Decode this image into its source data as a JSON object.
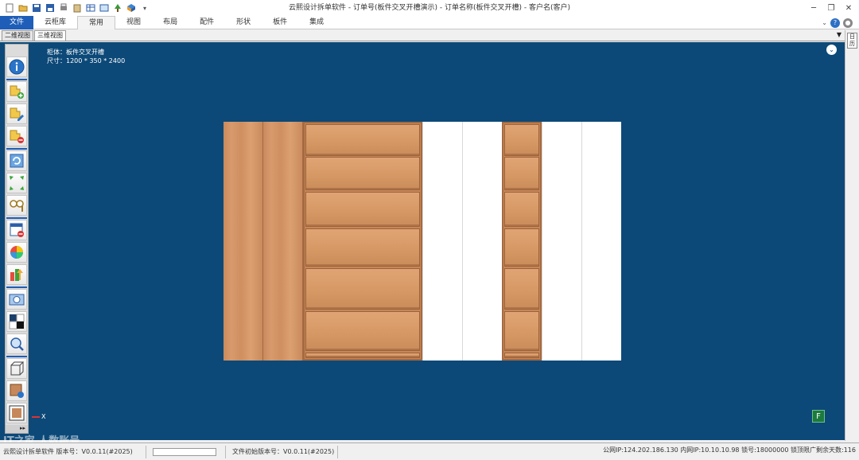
{
  "window": {
    "title": "云熙设计拆单软件 - 订单号(板件交叉开槽演示) - 订单名称(板件交叉开槽) - 客户名(客户)"
  },
  "ribbon": {
    "file_label": "文件",
    "tabs": [
      "云柜库",
      "常用",
      "视图",
      "布局",
      "配件",
      "形状",
      "板件",
      "集成"
    ],
    "active_tab": "常用"
  },
  "view_tabs": [
    "二维视图",
    "三维视图"
  ],
  "right_pane": {
    "label": "日历"
  },
  "canvas": {
    "info_line1": "柜体：板件交叉开槽",
    "info_line2": "尺寸：1200 * 350 * 2400",
    "axis_label": "X",
    "f_badge": "F",
    "bg_color": "#0c4978"
  },
  "left_toolbar": {
    "tools": [
      "info-icon",
      "add-cabinet-icon",
      "edit-cabinet-icon",
      "remove-cabinet-icon",
      "refresh-icon",
      "move-icon",
      "search-icon",
      "calendar-icon",
      "color-palette-icon",
      "sort-icon",
      "screenshot-icon",
      "contrast-icon",
      "zoom-icon",
      "wireframe-box-icon",
      "material-icon",
      "render-frame-icon"
    ]
  },
  "status": {
    "app": "云熙设计拆单软件 版本号：V0.0.11(#2025)",
    "file_version": "文件初始版本号：V0.0.11(#2025)",
    "network": "公网IP:124.202.186.130 内网IP:10.10.10.98 锁号:18000000 锁顶限广剩余天数:116"
  },
  "watermark": "IT之家 人数账号"
}
